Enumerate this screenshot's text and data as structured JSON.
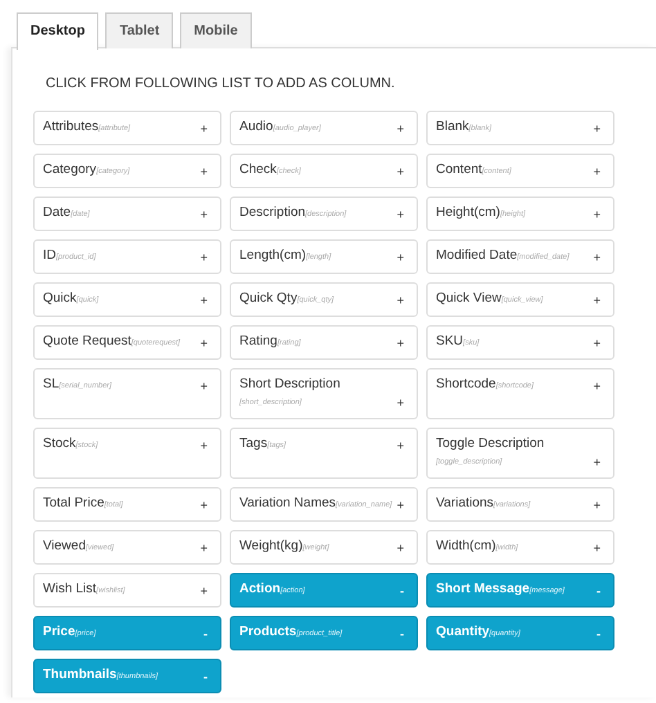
{
  "tabs": [
    {
      "label": "Desktop",
      "selected": true
    },
    {
      "label": "Tablet",
      "selected": false
    },
    {
      "label": "Mobile",
      "selected": false
    }
  ],
  "instruction": "CLICK FROM FOLLOWING LIST TO ADD AS COLUMN.",
  "columns": [
    {
      "label": "Attributes",
      "key": "[attribute]",
      "selected": false,
      "symbol": "+"
    },
    {
      "label": "Audio",
      "key": "[audio_player]",
      "selected": false,
      "symbol": "+"
    },
    {
      "label": "Blank",
      "key": "[blank]",
      "selected": false,
      "symbol": "+"
    },
    {
      "label": "Category",
      "key": "[category]",
      "selected": false,
      "symbol": "+"
    },
    {
      "label": "Check",
      "key": "[check]",
      "selected": false,
      "symbol": "+"
    },
    {
      "label": "Content",
      "key": "[content]",
      "selected": false,
      "symbol": "+"
    },
    {
      "label": "Date",
      "key": "[date]",
      "selected": false,
      "symbol": "+"
    },
    {
      "label": "Description",
      "key": "[description]",
      "selected": false,
      "symbol": "+"
    },
    {
      "label": "Height(cm)",
      "key": "[height]",
      "selected": false,
      "symbol": "+"
    },
    {
      "label": "ID",
      "key": "[product_id]",
      "selected": false,
      "symbol": "+"
    },
    {
      "label": "Length(cm)",
      "key": "[length]",
      "selected": false,
      "symbol": "+"
    },
    {
      "label": "Modified Date",
      "key": "[modified_date]",
      "selected": false,
      "symbol": "+"
    },
    {
      "label": "Quick",
      "key": "[quick]",
      "selected": false,
      "symbol": "+"
    },
    {
      "label": "Quick Qty",
      "key": "[quick_qty]",
      "selected": false,
      "symbol": "+"
    },
    {
      "label": "Quick View",
      "key": "[quick_view]",
      "selected": false,
      "symbol": "+"
    },
    {
      "label": "Quote Request",
      "key": "[quoterequest]",
      "selected": false,
      "symbol": "+"
    },
    {
      "label": "Rating",
      "key": "[rating]",
      "selected": false,
      "symbol": "+"
    },
    {
      "label": "SKU",
      "key": "[sku]",
      "selected": false,
      "symbol": "+"
    },
    {
      "label": "SL",
      "key": "[serial_number]",
      "selected": false,
      "symbol": "+"
    },
    {
      "label": "Short Description",
      "key": "[short_description]",
      "selected": false,
      "symbol": "+"
    },
    {
      "label": "Shortcode",
      "key": "[shortcode]",
      "selected": false,
      "symbol": "+"
    },
    {
      "label": "Stock",
      "key": "[stock]",
      "selected": false,
      "symbol": "+"
    },
    {
      "label": "Tags",
      "key": "[tags]",
      "selected": false,
      "symbol": "+"
    },
    {
      "label": "Toggle Description",
      "key": "[toggle_description]",
      "selected": false,
      "symbol": "+"
    },
    {
      "label": "Total Price",
      "key": "[total]",
      "selected": false,
      "symbol": "+"
    },
    {
      "label": "Variation Names",
      "key": "[variation_name]",
      "selected": false,
      "symbol": "+"
    },
    {
      "label": "Variations",
      "key": "[variations]",
      "selected": false,
      "symbol": "+"
    },
    {
      "label": "Viewed",
      "key": "[viewed]",
      "selected": false,
      "symbol": "+"
    },
    {
      "label": "Weight(kg)",
      "key": "[weight]",
      "selected": false,
      "symbol": "+"
    },
    {
      "label": "Width(cm)",
      "key": "[width]",
      "selected": false,
      "symbol": "+"
    },
    {
      "label": "Wish List",
      "key": "[wishlist]",
      "selected": false,
      "symbol": "+"
    },
    {
      "label": "Action",
      "key": "[action]",
      "selected": true,
      "symbol": "-"
    },
    {
      "label": "Short Message",
      "key": "[message]",
      "selected": true,
      "symbol": "-"
    },
    {
      "label": "Price",
      "key": "[price]",
      "selected": true,
      "symbol": "-"
    },
    {
      "label": "Products",
      "key": "[product_title]",
      "selected": true,
      "symbol": "-"
    },
    {
      "label": "Quantity",
      "key": "[quantity]",
      "selected": true,
      "symbol": "-"
    },
    {
      "label": "Thumbnails",
      "key": "[thumbnails]",
      "selected": true,
      "symbol": "-"
    }
  ]
}
